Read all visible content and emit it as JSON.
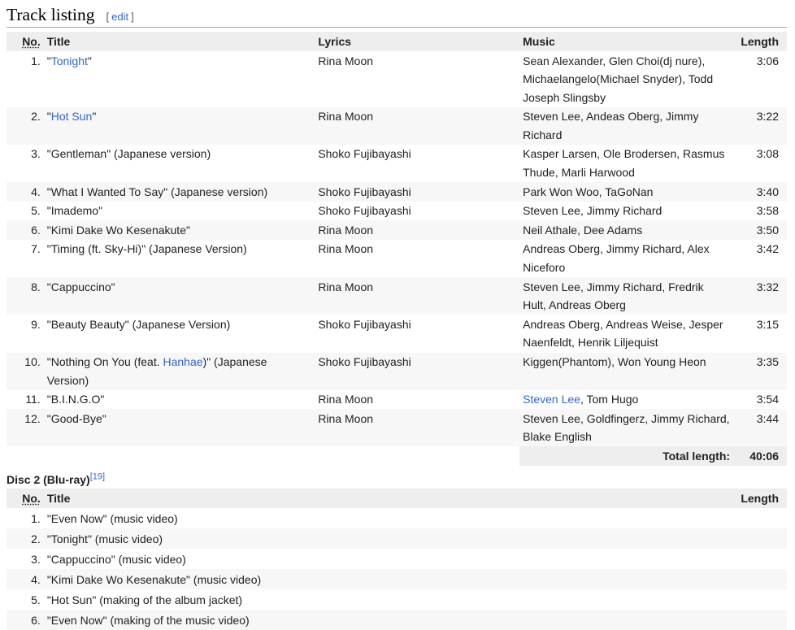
{
  "section": {
    "title": "Track listing",
    "edit_open": "[",
    "edit_label": "edit",
    "edit_close": "]"
  },
  "disc1": {
    "headers": {
      "no": "No.",
      "title": "Title",
      "lyrics": "Lyrics",
      "music": "Music",
      "length": "Length"
    },
    "tracks": [
      {
        "no": "1.",
        "title_pre": "\"",
        "title_link": "Tonight",
        "title_post": "\"",
        "lyrics": "Rina Moon",
        "music": "Sean Alexander, Glen Choi(dj nure), Michaelangelo(Michael Snyder), Todd Joseph Slingsby",
        "length": "3:06"
      },
      {
        "no": "2.",
        "title_pre": "\"",
        "title_link": "Hot Sun",
        "title_post": "\"",
        "lyrics": "Rina Moon",
        "music": "Steven Lee, Andeas Oberg, Jimmy Richard",
        "length": "3:22"
      },
      {
        "no": "3.",
        "title": "\"Gentleman\" (Japanese version)",
        "lyrics": "Shoko Fujibayashi",
        "music": "Kasper Larsen, Ole Brodersen, Rasmus Thude, Marli Harwood",
        "length": "3:08"
      },
      {
        "no": "4.",
        "title": "\"What I Wanted To Say\" (Japanese version)",
        "lyrics": "Shoko Fujibayashi",
        "music": "Park Won Woo, TaGoNan",
        "length": "3:40"
      },
      {
        "no": "5.",
        "title": "\"Imademo\"",
        "lyrics": "Shoko Fujibayashi",
        "music": "Steven Lee, Jimmy Richard",
        "length": "3:58"
      },
      {
        "no": "6.",
        "title": "\"Kimi Dake Wo Kesenakute\"",
        "lyrics": "Rina Moon",
        "music": "Neil Athale, Dee Adams",
        "length": "3:50"
      },
      {
        "no": "7.",
        "title": "\"Timing (ft. Sky-Hi)\" (Japanese Version)",
        "lyrics": "Rina Moon",
        "music": "Andreas Oberg, Jimmy Richard, Alex Niceforo",
        "length": "3:42"
      },
      {
        "no": "8.",
        "title": "\"Cappuccino\"",
        "lyrics": "Rina Moon",
        "music": "Steven Lee, Jimmy Richard, Fredrik Hult, Andreas Oberg",
        "length": "3:32"
      },
      {
        "no": "9.",
        "title": "\"Beauty Beauty\" (Japanese Version)",
        "lyrics": "Shoko Fujibayashi",
        "music": "Andreas Oberg, Andreas Weise, Jesper Naenfeldt, Henrik Liljequist",
        "length": "3:15"
      },
      {
        "no": "10.",
        "title_pre": "\"Nothing On You (feat. ",
        "title_link": "Hanhae",
        "title_post": ")\" (Japanese Version)",
        "lyrics": "Shoko Fujibayashi",
        "music": "Kiggen(Phantom), Won Young Heon",
        "length": "3:35"
      },
      {
        "no": "11.",
        "title": "\"B.I.N.G.O\"",
        "lyrics": "Rina Moon",
        "music_link": "Steven Lee",
        "music_post": ", Tom Hugo",
        "length": "3:54"
      },
      {
        "no": "12.",
        "title": "\"Good-Bye\"",
        "lyrics": "Rina Moon",
        "music": "Steven Lee, Goldfingerz, Jimmy Richard, Blake English",
        "length": "3:44"
      }
    ],
    "total_label": "Total length:",
    "total_value": "40:06"
  },
  "disc2": {
    "heading": "Disc 2 (Blu-ray)",
    "ref": "[19]",
    "headers": {
      "no": "No.",
      "title": "Title",
      "length": "Length"
    },
    "tracks": [
      {
        "no": "1.",
        "title": "\"Even Now\" (music video)"
      },
      {
        "no": "2.",
        "title": "\"Tonight\" (music video)"
      },
      {
        "no": "3.",
        "title": "\"Cappuccino\" (music video)"
      },
      {
        "no": "4.",
        "title": "\"Kimi Dake Wo Kesenakute\" (music video)"
      },
      {
        "no": "5.",
        "title": "\"Hot Sun\" (making of the album jacket)"
      },
      {
        "no": "6.",
        "title": "\"Even Now\" (making of the music video)"
      }
    ]
  }
}
